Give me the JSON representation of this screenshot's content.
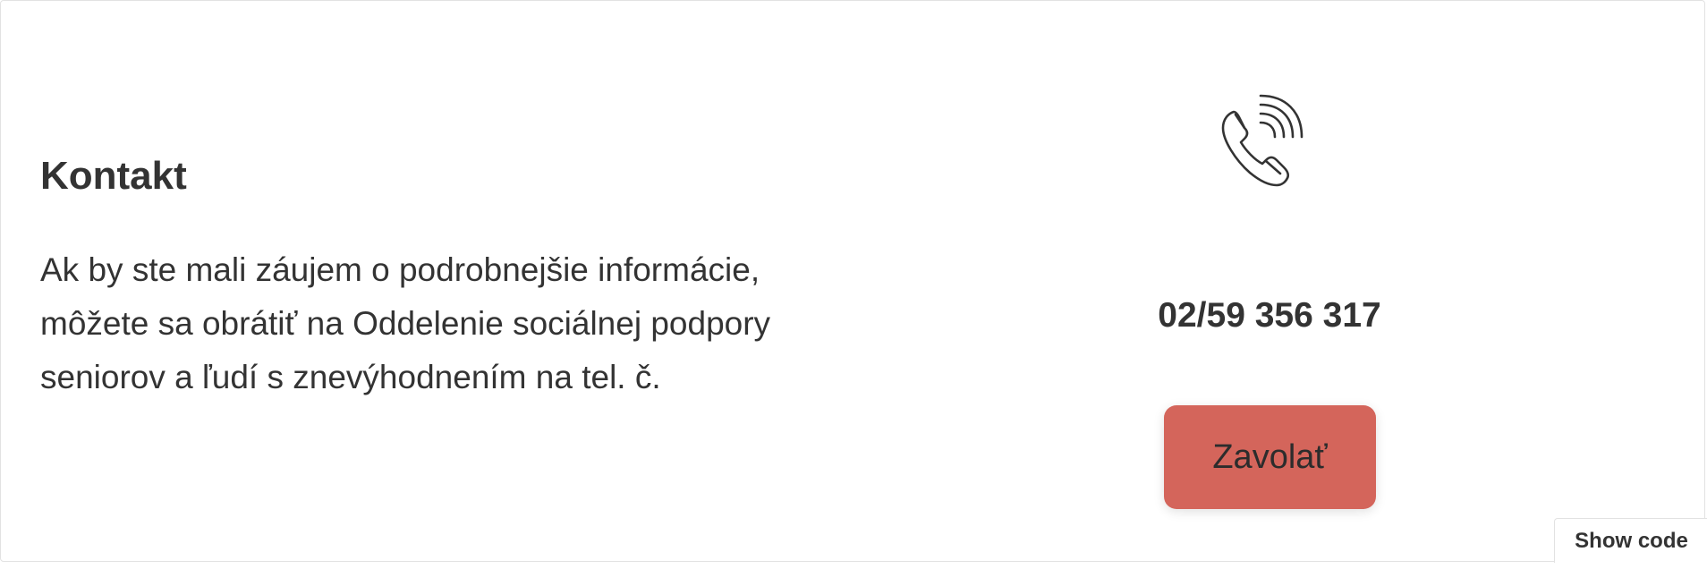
{
  "contact": {
    "title": "Kontakt",
    "description": "Ak by ste mali záujem o podrobnejšie informácie, môžete sa obrátiť na Oddelenie sociálnej podpory seniorov a ľudí s znevýhodnením na tel. č.",
    "phone_icon": "phone-ringing-icon",
    "phone_number": "02/59 356 317",
    "call_button_label": "Zavolať"
  },
  "show_code_label": "Show code",
  "colors": {
    "button_bg": "#d4655b",
    "text": "#333333",
    "border": "#e2e2e2"
  }
}
